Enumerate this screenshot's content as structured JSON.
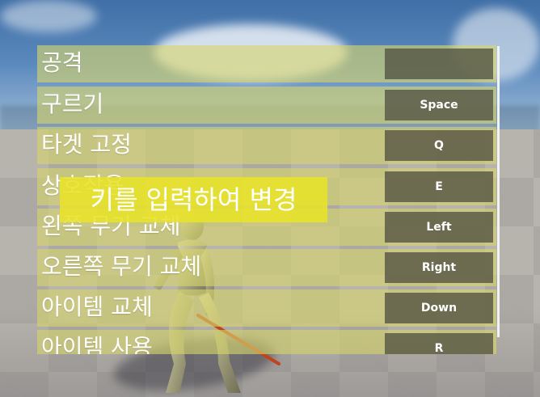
{
  "menu": {
    "rows": [
      {
        "action": "공격",
        "key": ""
      },
      {
        "action": "구르기",
        "key": "Space"
      },
      {
        "action": "타겟 고정",
        "key": "Q"
      },
      {
        "action": "상호작용",
        "key": "E"
      },
      {
        "action": "왼쪽 무기 교체",
        "key": "Left"
      },
      {
        "action": "오른쪽 무기 교체",
        "key": "Right"
      },
      {
        "action": "아이템 교체",
        "key": "Down"
      },
      {
        "action": "아이템 사용",
        "key": "R"
      }
    ]
  },
  "prompt": {
    "text": "키를 입력하여 변경"
  },
  "colors": {
    "row_bg": "#d6d56c",
    "key_bg": "#585846",
    "prompt_bg": "#e8e228"
  }
}
